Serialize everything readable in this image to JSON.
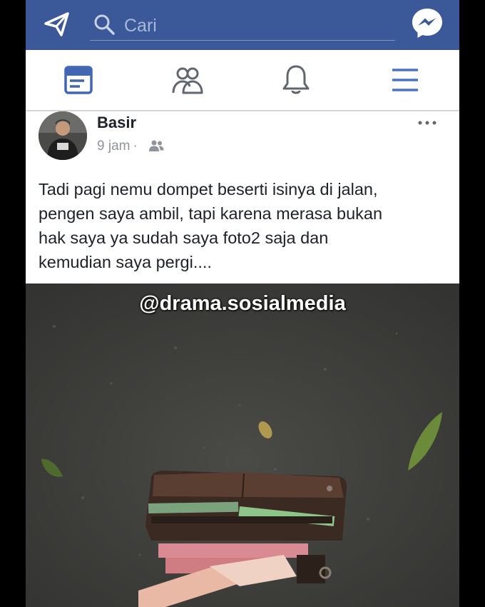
{
  "search": {
    "placeholder": "Cari"
  },
  "icons": {
    "send": "paper-plane-icon",
    "search": "search-icon",
    "messenger": "messenger-icon",
    "news_feed": "news-feed-icon",
    "friends": "friends-icon",
    "notifications": "bell-icon",
    "menu": "hamburger-menu-icon",
    "audience": "friends-audience-icon",
    "more": "more-options-icon"
  },
  "colors": {
    "brand_blue": "#3b5998",
    "nav_active": "#4267b2",
    "nav_inactive": "#606770"
  },
  "post": {
    "author": "Basir",
    "time": "9 jam",
    "separator": "·",
    "text_lines": [
      "Tadi pagi nemu dompet beserti isinya di jalan,",
      "pengen saya ambil, tapi karena merasa bukan",
      "hak saya ya sudah saya foto2 saja dan",
      "kemudian saya pergi...."
    ],
    "image_watermark": "@drama.sosialmedia"
  }
}
